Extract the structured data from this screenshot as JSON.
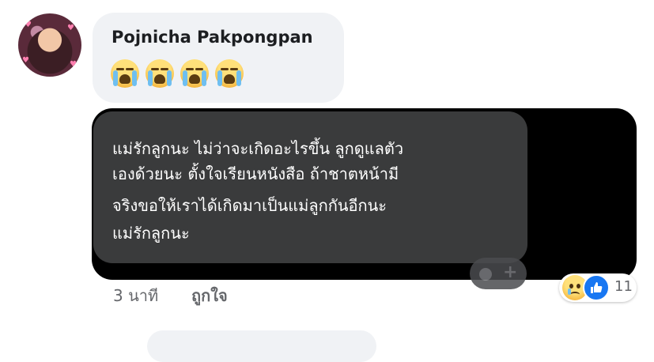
{
  "comment": {
    "author": "Pojnicha Pakpongpan",
    "emojis": [
      "crying-face",
      "crying-face",
      "crying-face",
      "crying-face"
    ],
    "image_message": {
      "lines": [
        "แม่รักลูกนะ ไม่ว่าจะเกิดอะไรขึ้น ลูกดูแลตัว",
        "เองด้วยนะ ตั้งใจเรียนหนังสือ ถ้าชาตหน้ามี",
        "จริงขอให้เราได้เกิดมาเป็นแม่ลูกกันอีกนะ",
        "แม่รักลูกนะ"
      ]
    },
    "meta": {
      "time": "3 นาที",
      "like_label": "ถูกใจ"
    },
    "reactions": {
      "icons": [
        "sad-reaction",
        "like-reaction"
      ],
      "count": "11"
    }
  },
  "colors": {
    "bubble_bg": "#f0f2f5",
    "media_bg": "#000000",
    "message_bubble_bg": "#3a3b3c",
    "like_blue": "#1877f2",
    "meta_text": "#65676b"
  }
}
